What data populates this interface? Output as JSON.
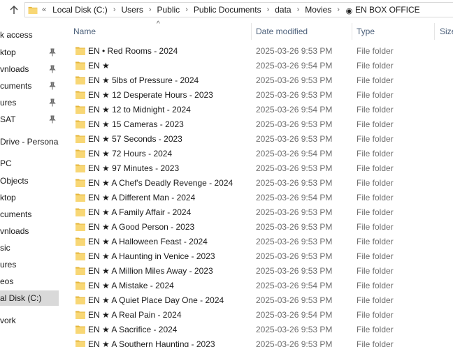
{
  "address_bar": {
    "overflow": "«",
    "crumbs": [
      "Local Disk (C:)",
      "Users",
      "Public",
      "Public Documents",
      "data",
      "Movies",
      "EN BOX OFFICE"
    ]
  },
  "nav_pane": {
    "items": [
      {
        "label": "k access",
        "pinned": false
      },
      {
        "label": "ktop",
        "pinned": true
      },
      {
        "label": "vnloads",
        "pinned": true
      },
      {
        "label": "cuments",
        "pinned": true
      },
      {
        "label": "ures",
        "pinned": true
      },
      {
        "label": "SAT",
        "pinned": true
      },
      {
        "label": "Drive - Personal",
        "pinned": false
      },
      {
        "label": "PC",
        "pinned": false
      },
      {
        "label": "Objects",
        "pinned": false
      },
      {
        "label": "ktop",
        "pinned": false
      },
      {
        "label": "cuments",
        "pinned": false
      },
      {
        "label": "vnloads",
        "pinned": false
      },
      {
        "label": "sic",
        "pinned": false
      },
      {
        "label": "ures",
        "pinned": false
      },
      {
        "label": "eos",
        "pinned": false
      },
      {
        "label": "al Disk (C:)",
        "pinned": false,
        "selected": true
      },
      {
        "label": "vork",
        "pinned": false
      }
    ]
  },
  "columns": {
    "name": "Name",
    "date_modified": "Date modified",
    "type": "Type",
    "size": "Size"
  },
  "files": [
    {
      "name": "EN • Red Rooms - 2024",
      "date": "2025-03-26 9:53 PM",
      "type": "File folder"
    },
    {
      "name": "EN ★",
      "date": "2025-03-26 9:54 PM",
      "type": "File folder"
    },
    {
      "name": "EN ★ 5lbs of Pressure - 2024",
      "date": "2025-03-26 9:53 PM",
      "type": "File folder"
    },
    {
      "name": "EN ★ 12 Desperate Hours - 2023",
      "date": "2025-03-26 9:53 PM",
      "type": "File folder"
    },
    {
      "name": "EN ★ 12 to Midnight - 2024",
      "date": "2025-03-26 9:54 PM",
      "type": "File folder"
    },
    {
      "name": "EN ★ 15 Cameras - 2023",
      "date": "2025-03-26 9:53 PM",
      "type": "File folder"
    },
    {
      "name": "EN ★ 57 Seconds - 2023",
      "date": "2025-03-26 9:53 PM",
      "type": "File folder"
    },
    {
      "name": "EN ★ 72 Hours - 2024",
      "date": "2025-03-26 9:54 PM",
      "type": "File folder"
    },
    {
      "name": "EN ★ 97 Minutes - 2023",
      "date": "2025-03-26 9:53 PM",
      "type": "File folder"
    },
    {
      "name": "EN ★ A Chef's Deadly Revenge - 2024",
      "date": "2025-03-26 9:53 PM",
      "type": "File folder"
    },
    {
      "name": "EN ★ A Different Man - 2024",
      "date": "2025-03-26 9:54 PM",
      "type": "File folder"
    },
    {
      "name": "EN ★ A Family Affair - 2024",
      "date": "2025-03-26 9:53 PM",
      "type": "File folder"
    },
    {
      "name": "EN ★ A Good Person - 2023",
      "date": "2025-03-26 9:53 PM",
      "type": "File folder"
    },
    {
      "name": "EN ★ A Halloween Feast - 2024",
      "date": "2025-03-26 9:53 PM",
      "type": "File folder"
    },
    {
      "name": "EN ★ A Haunting in Venice - 2023",
      "date": "2025-03-26 9:53 PM",
      "type": "File folder"
    },
    {
      "name": "EN ★ A Million Miles Away - 2023",
      "date": "2025-03-26 9:53 PM",
      "type": "File folder"
    },
    {
      "name": "EN ★ A Mistake - 2024",
      "date": "2025-03-26 9:54 PM",
      "type": "File folder"
    },
    {
      "name": "EN ★ A Quiet Place Day One - 2024",
      "date": "2025-03-26 9:53 PM",
      "type": "File folder"
    },
    {
      "name": "EN ★ A Real Pain - 2024",
      "date": "2025-03-26 9:54 PM",
      "type": "File folder"
    },
    {
      "name": "EN ★ A Sacrifice - 2024",
      "date": "2025-03-26 9:53 PM",
      "type": "File folder"
    },
    {
      "name": "EN ★ A Southern Haunting - 2023",
      "date": "2025-03-26 9:53 PM",
      "type": "File folder"
    }
  ],
  "colors": {
    "folder_yellow": "#f8d775",
    "folder_dark": "#e5b53a",
    "header_text": "#4c607a",
    "selected_bg": "#d9d9d9"
  }
}
